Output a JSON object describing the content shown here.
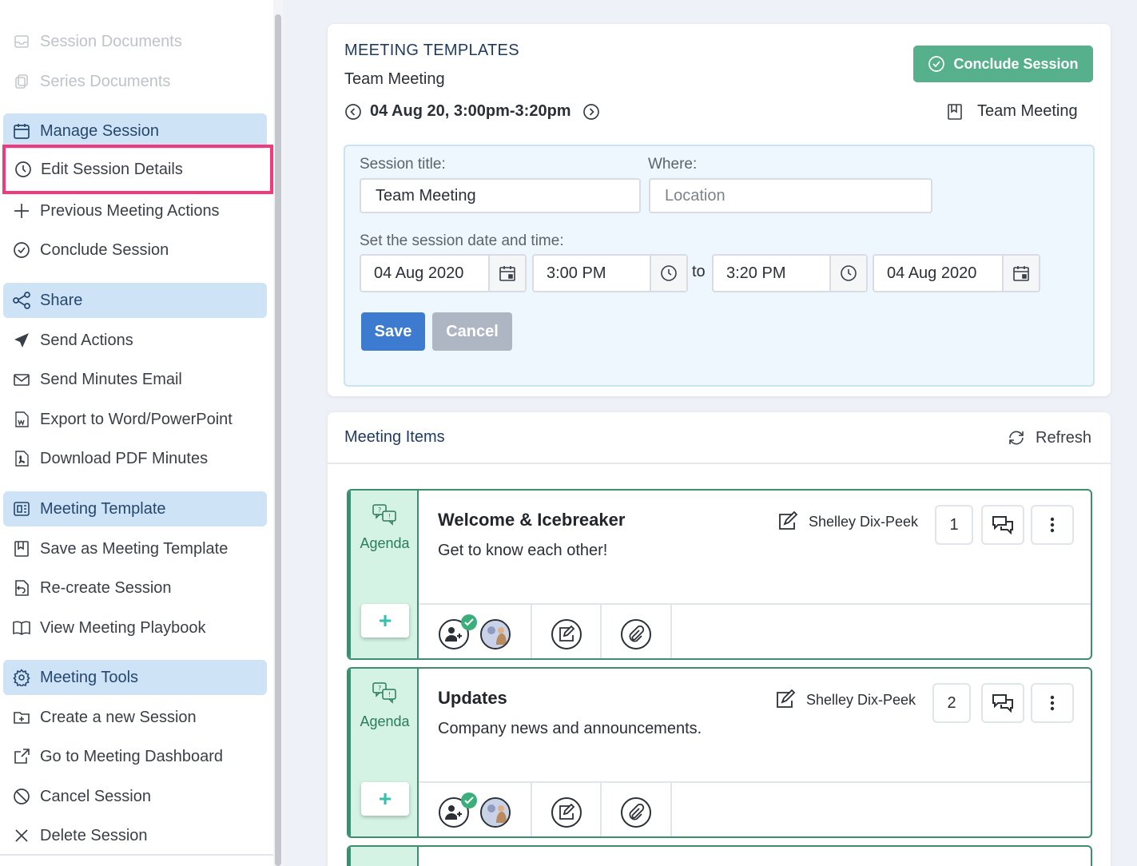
{
  "sidebar": {
    "items": [
      {
        "label": "Session Documents",
        "icon": "document-icon",
        "state": "disabled"
      },
      {
        "label": "Series Documents",
        "icon": "documents-icon",
        "state": "disabled"
      },
      {
        "label": "Manage Session",
        "icon": "calendar-icon",
        "state": "header"
      },
      {
        "label": "Edit Session Details",
        "icon": "clock-icon",
        "state": "highlighted"
      },
      {
        "label": "Previous Meeting Actions",
        "icon": "plus-icon",
        "state": "normal"
      },
      {
        "label": "Conclude Session",
        "icon": "check-circle-icon",
        "state": "normal"
      },
      {
        "label": "Share",
        "icon": "share-icon",
        "state": "header"
      },
      {
        "label": "Send Actions",
        "icon": "send-icon",
        "state": "normal"
      },
      {
        "label": "Send Minutes Email",
        "icon": "envelope-icon",
        "state": "normal"
      },
      {
        "label": "Export to Word/PowerPoint",
        "icon": "word-file-icon",
        "state": "normal"
      },
      {
        "label": "Download PDF Minutes",
        "icon": "pdf-file-icon",
        "state": "normal"
      },
      {
        "label": "Meeting Template",
        "icon": "template-icon",
        "state": "header"
      },
      {
        "label": "Save as Meeting Template",
        "icon": "bookmark-icon",
        "state": "normal"
      },
      {
        "label": "Re-create Session",
        "icon": "recreate-icon",
        "state": "normal"
      },
      {
        "label": "View Meeting Playbook",
        "icon": "book-icon",
        "state": "normal"
      },
      {
        "label": "Meeting Tools",
        "icon": "gear-icon",
        "state": "header"
      },
      {
        "label": "Create a new Session",
        "icon": "folder-plus-icon",
        "state": "normal"
      },
      {
        "label": "Go to Meeting Dashboard",
        "icon": "external-link-icon",
        "state": "normal"
      },
      {
        "label": "Cancel Session",
        "icon": "ban-icon",
        "state": "normal"
      },
      {
        "label": "Delete Session",
        "icon": "x-icon",
        "state": "normal"
      }
    ]
  },
  "template_card": {
    "title": "MEETING TEMPLATES",
    "subtitle": "Team Meeting",
    "date_range": "04 Aug 20, 3:00pm-3:20pm",
    "conclude_label": "Conclude Session",
    "template_name": "Team Meeting",
    "form": {
      "session_title_label": "Session title:",
      "session_title_value": "Team Meeting",
      "where_label": "Where:",
      "where_placeholder": "Location",
      "datetime_label": "Set the session date and time:",
      "start_date": "04 Aug 2020",
      "start_time": "3:00 PM",
      "to_label": "to",
      "end_time": "3:20 PM",
      "end_date": "04 Aug 2020",
      "save_label": "Save",
      "cancel_label": "Cancel"
    }
  },
  "items_card": {
    "title": "Meeting Items",
    "refresh_label": "Refresh",
    "items": [
      {
        "type": "Agenda",
        "title": "Welcome & Icebreaker",
        "description": "Get to know each other!",
        "owner": "Shelley Dix-Peek",
        "number": "1"
      },
      {
        "type": "Agenda",
        "title": "Updates",
        "description": "Company news and announcements.",
        "owner": "Shelley Dix-Peek",
        "number": "2"
      }
    ]
  },
  "colors": {
    "accent_green": "#55b08b",
    "header_blue": "#cfe3f7",
    "save_blue": "#3d7bd0",
    "highlight_pink": "#f03a7b",
    "agenda_bg": "#d4f3e4"
  }
}
